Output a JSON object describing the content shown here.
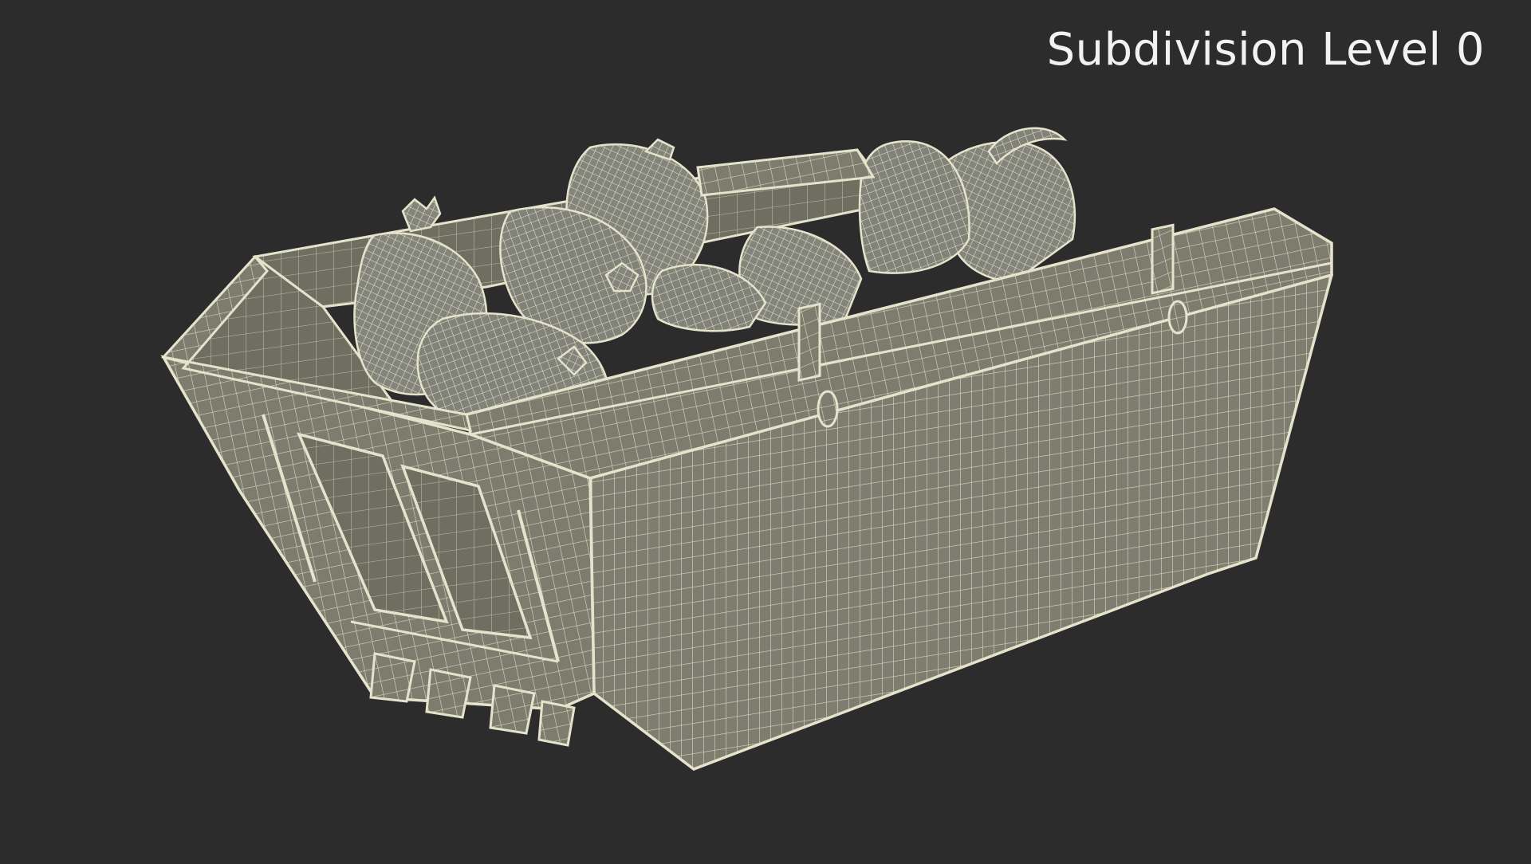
{
  "overlay": {
    "label": "Subdivision Level 0"
  },
  "colors": {
    "background": "#2c2c2c",
    "surface": "#7c7d6e",
    "wire": "#e6e3cc",
    "label": "#f2f2f2"
  },
  "scene": {
    "object": "skip-bin-with-garbage-bags",
    "render_mode": "wireframe"
  }
}
